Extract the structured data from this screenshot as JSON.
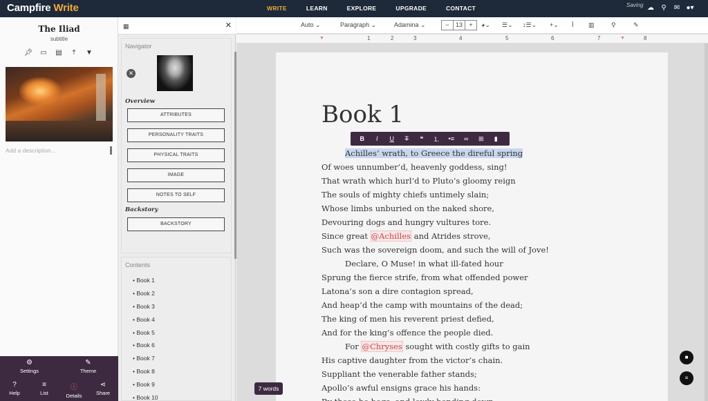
{
  "brand": {
    "part1": "Campfire",
    "part2": "Write"
  },
  "nav": {
    "items": [
      "WRITE",
      "LEARN",
      "EXPLORE",
      "UPGRADE",
      "CONTACT"
    ],
    "active": "WRITE"
  },
  "status": {
    "saving": "Saving"
  },
  "topicons": [
    "cloud-icon",
    "search-icon",
    "mail-icon",
    "user-icon"
  ],
  "left": {
    "title": "The Iliad",
    "subtitle": "subtitle",
    "description_placeholder": "Add a description...",
    "bottom": [
      {
        "label": "Settings",
        "icon": "gear-icon"
      },
      {
        "label": "Theme",
        "icon": "brush-icon"
      },
      {
        "label": "Help",
        "icon": "help-icon"
      },
      {
        "label": "List",
        "icon": "list-icon"
      },
      {
        "label": "Details",
        "icon": "info-icon"
      },
      {
        "label": "Share",
        "icon": "share-icon"
      }
    ]
  },
  "navigator": {
    "label": "Navigator",
    "overview_label": "Overview",
    "buttons": [
      "ATTRIBUTES",
      "PERSONALITY TRAITS",
      "PHYSICAL TRAITS",
      "IMAGE",
      "NOTES TO SELF"
    ],
    "backstory_label": "Backstory",
    "backstory_button": "BACKSTORY"
  },
  "contents": {
    "label": "Contents",
    "items": [
      "Book 1",
      "Book 2",
      "Book 3",
      "Book 4",
      "Book 5",
      "Book 6",
      "Book 7",
      "Book 8",
      "Book 9",
      "Book 10"
    ]
  },
  "toolbar": {
    "font_size_auto": "Auto",
    "style": "Paragraph",
    "font": "Adamina",
    "size_minus": "−",
    "size": "13",
    "size_plus": "+"
  },
  "ruler": [
    "1",
    "2",
    "3",
    "4",
    "5",
    "6",
    "7",
    "8"
  ],
  "page": {
    "title": "Book 1",
    "lines": [
      {
        "text": "Achilles’ wrath, to Greece the direful spring",
        "indent": true,
        "highlight": true
      },
      {
        "text": "Of woes unnumber’d, heavenly goddess, sing!"
      },
      {
        "text": "That wrath which hurl’d to Pluto’s gloomy reign"
      },
      {
        "text": "The souls of mighty chiefs untimely slain;"
      },
      {
        "text": "Whose limbs unburied on the naked shore,"
      },
      {
        "text": "Devouring dogs and hungry vultures tore."
      },
      {
        "pre": "Since great ",
        "mention": "@Achilles",
        "post": " and Atrides strove,"
      },
      {
        "text": "Such was the sovereign doom, and such the will of Jove!"
      },
      {
        "text": "Declare, O Muse! in what ill-fated hour",
        "indent": true
      },
      {
        "text": "Sprung the fierce strife, from what offended power"
      },
      {
        "text": "Latona’s son a dire contagion spread,"
      },
      {
        "text": "And heap’d the camp with mountains of the dead;"
      },
      {
        "text": "The king of men his reverent priest defied,"
      },
      {
        "text": "And for the king’s offence the people died."
      },
      {
        "pre": "For ",
        "mention": "@Chryses",
        "post": " sought with costly gifts to gain",
        "indent": true
      },
      {
        "text": "His captive daughter from the victor’s chain."
      },
      {
        "text": "Suppliant the venerable father stands;"
      },
      {
        "text": "Apollo’s awful ensigns grace his hands:"
      },
      {
        "text": "By these he begs; and lowly bending down,"
      }
    ]
  },
  "word_count": "7 words",
  "colors": {
    "nav_bg": "#1e2a3a",
    "accent": "#f2a93b",
    "purple": "#3d2a40"
  }
}
